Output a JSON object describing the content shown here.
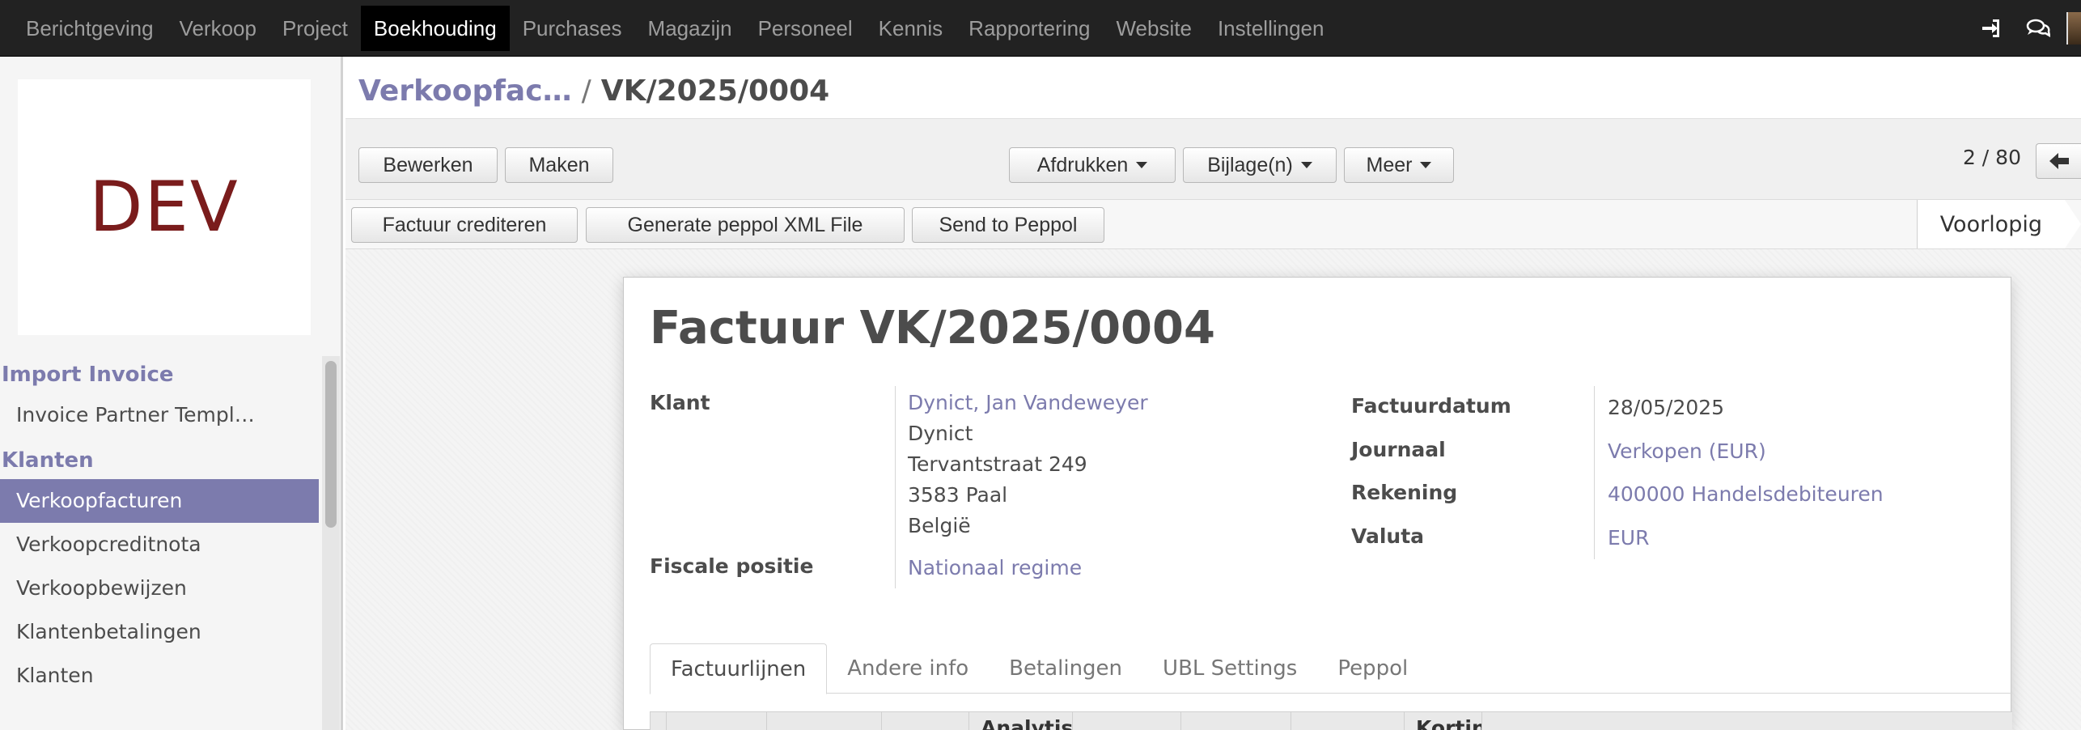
{
  "topbar": {
    "menu": [
      "Berichtgeving",
      "Verkoop",
      "Project",
      "Boekhouding",
      "Purchases",
      "Magazijn",
      "Personeel",
      "Kennis",
      "Rapportering",
      "Website",
      "Instellingen"
    ],
    "active_index": 3,
    "icons": [
      "sign-in-icon",
      "chat-bubbles-icon",
      "user-avatar"
    ]
  },
  "sidebar": {
    "logo_text": "DEV",
    "sections": [
      {
        "title": "Import Invoice",
        "items": [
          "Invoice Partner Templ…"
        ]
      },
      {
        "title": "Klanten",
        "items": [
          "Verkoopfacturen",
          "Verkoopcreditnota",
          "Verkoopbewijzen",
          "Klantenbetalingen",
          "Klanten"
        ]
      }
    ],
    "active_item": "Verkoopfacturen"
  },
  "breadcrumb": {
    "parent": "Verkoopfac…",
    "separator": "/",
    "current": "VK/2025/0004"
  },
  "toolbar": {
    "edit_label": "Bewerken",
    "create_label": "Maken",
    "print_label": "Afdrukken",
    "attachments_label": "Bijlage(n)",
    "more_label": "Meer",
    "pager": "2 / 80"
  },
  "header_buttons": [
    "Factuur crediteren",
    "Generate peppol XML File",
    "Send to Peppol"
  ],
  "status": {
    "current_stage": "Voorlopig"
  },
  "invoice": {
    "title": "Factuur VK/2025/0004",
    "left": {
      "customer_label": "Klant",
      "customer_name": "Dynict, Jan Vandeweyer",
      "address_lines": [
        "Dynict",
        "Tervantstraat 249",
        "3583 Paal",
        "België"
      ],
      "fiscal_label": "Fiscale positie",
      "fiscal_value": "Nationaal regime"
    },
    "right": {
      "date_label": "Factuurdatum",
      "date_value": "28/05/2025",
      "journal_label": "Journaal",
      "journal_value": "Verkopen (EUR)",
      "account_label": "Rekening",
      "account_value": "400000 Handelsdebiteuren",
      "currency_label": "Valuta",
      "currency_value": "EUR"
    },
    "tabs": [
      "Factuurlijnen",
      "Andere info",
      "Betalingen",
      "UBL Settings",
      "Peppol"
    ],
    "active_tab": 0,
    "table_headers": [
      "Analytische",
      "Korting"
    ]
  },
  "colors": {
    "accent": "#7c7bad",
    "topbar": "#222222",
    "active_top": "#000000"
  }
}
